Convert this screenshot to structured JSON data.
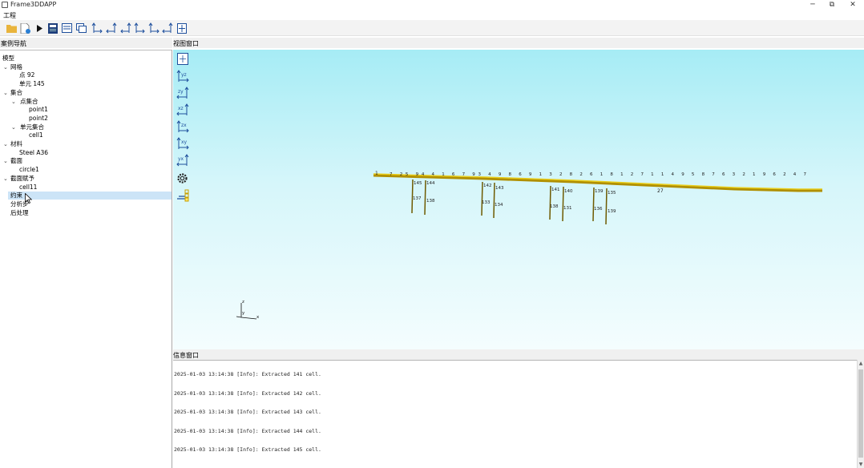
{
  "window": {
    "title": "Frame3DDAPP",
    "minimize_label": "─",
    "restore_label": "⧉",
    "close_label": "✕"
  },
  "menu": {
    "items": [
      "工程"
    ]
  },
  "toolbar": {
    "icons": [
      "folder-open-icon",
      "new-file-icon",
      "run-icon",
      "save-icon",
      "copy-view-icon",
      "layers-icon",
      "view-xy-icon",
      "view-yx-icon",
      "view-xz-icon",
      "view-zx-icon",
      "view-yz-icon",
      "view-zy-icon",
      "fit-view-icon"
    ]
  },
  "left_panel": {
    "header": "案例导航",
    "tree": [
      {
        "label": "模型",
        "level": 0,
        "expandable": false
      },
      {
        "label": "网格",
        "level": 0,
        "expandable": true
      },
      {
        "label": "点 92",
        "level": 1,
        "expandable": false
      },
      {
        "label": "单元 145",
        "level": 1,
        "expandable": false
      },
      {
        "label": "集合",
        "level": 0,
        "expandable": true
      },
      {
        "label": "点集合",
        "level": 1,
        "expandable": true
      },
      {
        "label": "point1",
        "level": 2,
        "expandable": false
      },
      {
        "label": "point2",
        "level": 2,
        "expandable": false
      },
      {
        "label": "单元集合",
        "level": 1,
        "expandable": true
      },
      {
        "label": "cell1",
        "level": 2,
        "expandable": false
      },
      {
        "label": "材料",
        "level": 0,
        "expandable": true
      },
      {
        "label": "Steel A36",
        "level": 1,
        "expandable": false
      },
      {
        "label": "截面",
        "level": 0,
        "expandable": true
      },
      {
        "label": "circle1",
        "level": 1,
        "expandable": false
      },
      {
        "label": "截面赋予",
        "level": 0,
        "expandable": true
      },
      {
        "label": "cell11",
        "level": 1,
        "expandable": false
      },
      {
        "label": "约束",
        "level": 0,
        "expandable": false,
        "selected": true
      },
      {
        "label": "分析步",
        "level": 0,
        "expandable": false
      },
      {
        "label": "后处理",
        "level": 0,
        "expandable": false
      }
    ]
  },
  "view": {
    "header": "视图窗口",
    "buttons": [
      "fit-all-icon",
      "view-yz-icon",
      "view-zy-icon",
      "view-xz-icon",
      "view-zx-icon",
      "view-xy-icon",
      "view-yx-icon",
      "settings-gear-icon",
      "layers-icon"
    ],
    "button_labels": [
      "",
      "yz",
      "zy",
      "xz",
      "zx",
      "xy",
      "yx",
      "",
      ""
    ],
    "node_labels": {
      "left_end": "1",
      "right_end": "27",
      "deck_text": "7 25 94 4 1 6 7 93 4 9 8 6 9 1 3 2 8 2 6 1 8 1 2 7 1 1 4 9 5 8 7 6 3 2 1 9 6 2 4 7",
      "columns": [
        "145",
        "144",
        "137",
        "138",
        "142",
        "143",
        "133",
        "134",
        "141",
        "140",
        "139",
        "135",
        "138",
        "131",
        "136",
        "139"
      ]
    },
    "axis_labels": {
      "z": "z",
      "x": "x",
      "y": "y"
    }
  },
  "log": {
    "header": "信息窗口",
    "lines": [
      "2025-01-03 13:14:38 [Info]: Extracted  141  cell.",
      "2025-01-03 13:14:38 [Info]: Extracted  142  cell.",
      "2025-01-03 13:14:38 [Info]: Extracted  143  cell.",
      "2025-01-03 13:14:38 [Info]: Extracted  144  cell.",
      "2025-01-03 13:14:38 [Info]: Extracted  145  cell."
    ]
  },
  "colors": {
    "accent_blue": "#1e4f9c",
    "view_top": "#a6ecf5",
    "view_bottom": "#f4fdfe",
    "deck": "#e0c400",
    "selection": "#cce4f7"
  }
}
